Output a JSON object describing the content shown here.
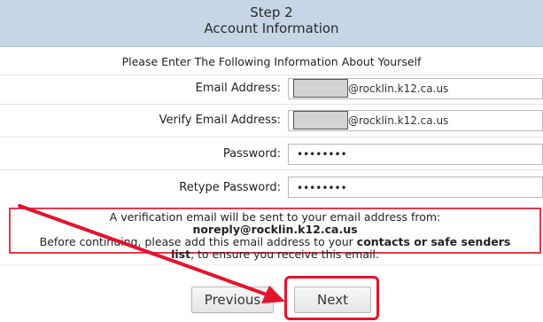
{
  "header": {
    "step": "Step 2",
    "title": "Account Information"
  },
  "intro": "Please Enter The Following Information About Yourself",
  "form": {
    "email_label": "Email Address:",
    "email_domain": "@rocklin.k12.ca.us",
    "verify_label": "Verify Email Address:",
    "verify_domain": "@rocklin.k12.ca.us",
    "password_label": "Password:",
    "password_value": "••••••••",
    "retype_label": "Retype Password:",
    "retype_value": "••••••••"
  },
  "notice": {
    "line1": "A verification email will be sent to your email address from:",
    "sender": "noreply@rocklin.k12.ca.us",
    "line3_pre": "Before continuing, please add this email address to your ",
    "line3_bold": "contacts or safe senders",
    "line4_bold": "list",
    "line4_post": ", to ensure you receive this email."
  },
  "buttons": {
    "previous": "Previous",
    "next": "Next"
  },
  "colors": {
    "header_bg": "#c6d6e6",
    "annotation_red": "#e4132c"
  }
}
